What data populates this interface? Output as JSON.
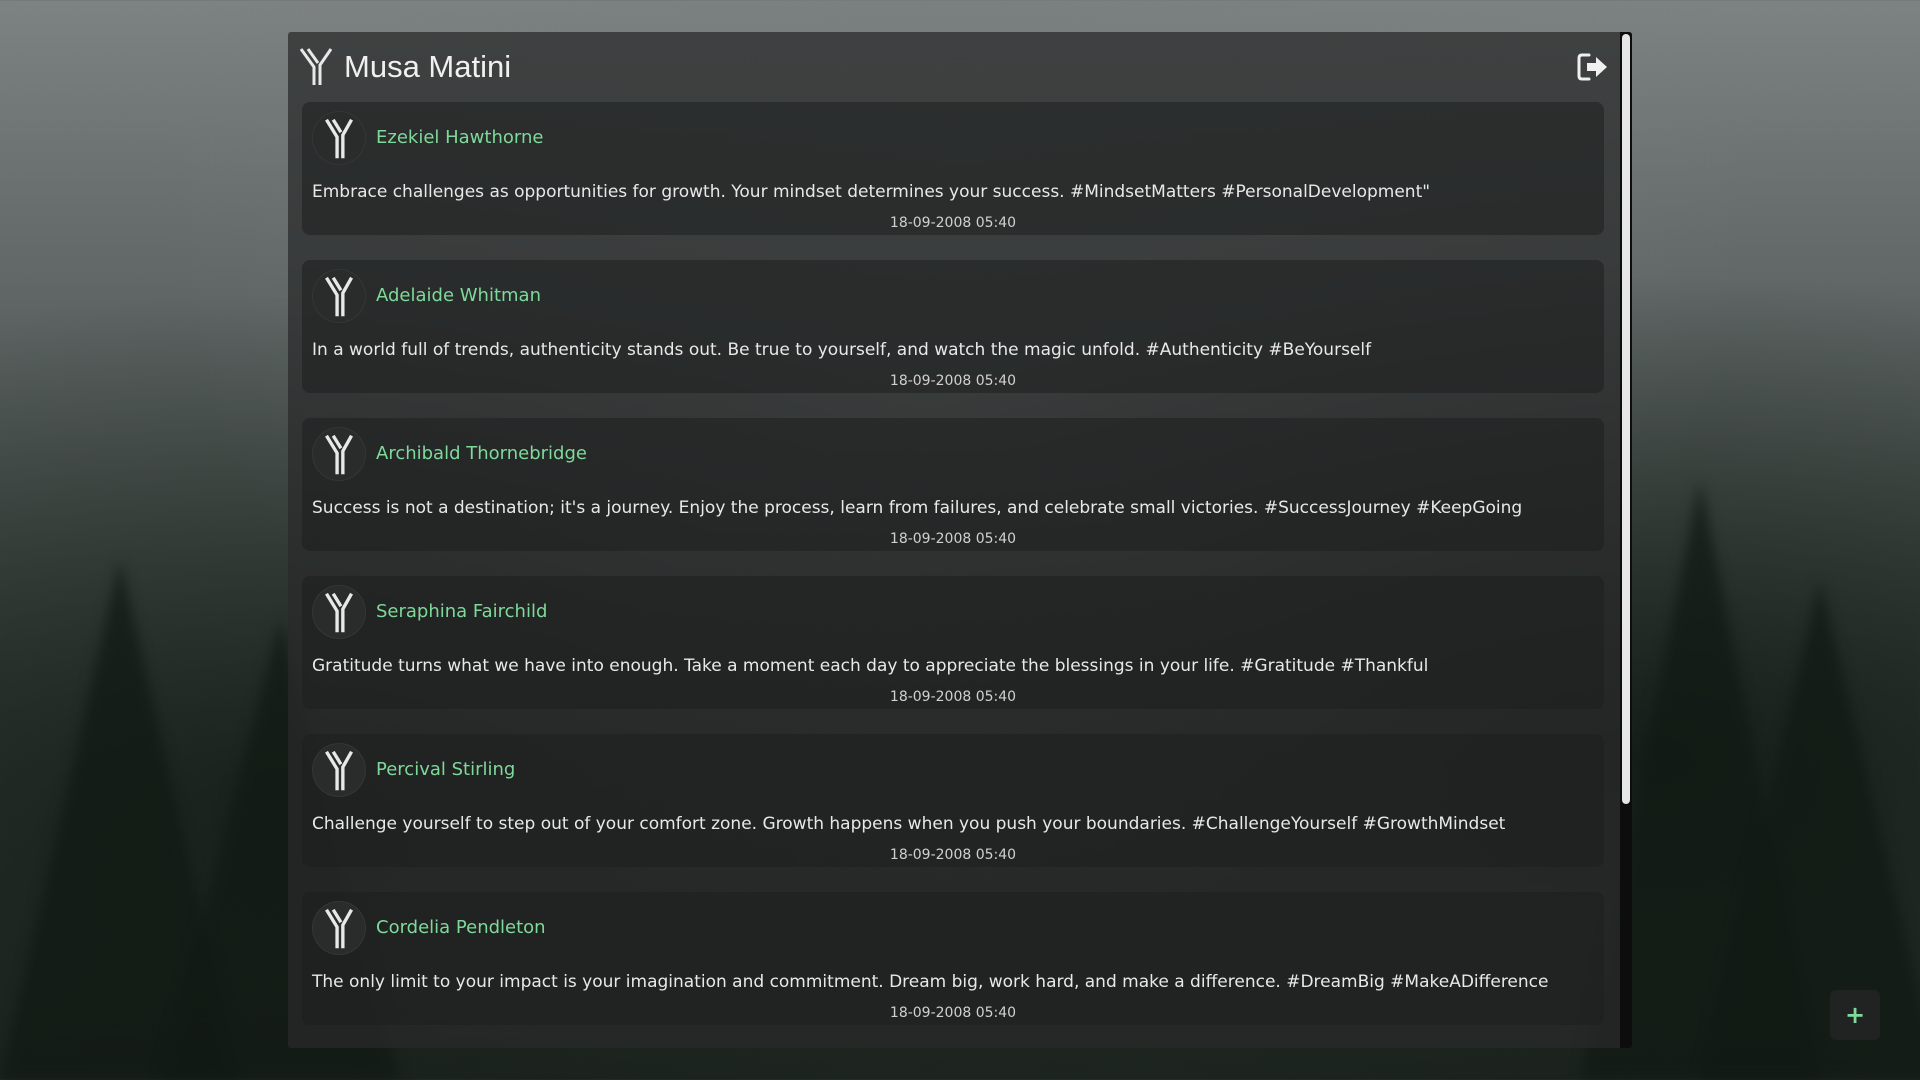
{
  "header": {
    "title": "Musa Matini",
    "logo_icon": "y-logo-icon",
    "logout_icon": "logout-icon"
  },
  "posts": [
    {
      "author": "Ezekiel Hawthorne",
      "text": "Embrace challenges as opportunities for growth. Your mindset determines your success. #MindsetMatters #PersonalDevelopment\"",
      "time": "18-09-2008 05:40"
    },
    {
      "author": "Adelaide Whitman",
      "text": "In a world full of trends, authenticity stands out. Be true to yourself, and watch the magic unfold. #Authenticity #BeYourself",
      "time": "18-09-2008 05:40"
    },
    {
      "author": "Archibald Thornebridge",
      "text": "Success is not a destination; it's a journey. Enjoy the process, learn from failures, and celebrate small victories. #SuccessJourney #KeepGoing",
      "time": "18-09-2008 05:40"
    },
    {
      "author": "Seraphina Fairchild",
      "text": "Gratitude turns what we have into enough. Take a moment each day to appreciate the blessings in your life. #Gratitude #Thankful",
      "time": "18-09-2008 05:40"
    },
    {
      "author": "Percival Stirling",
      "text": "Challenge yourself to step out of your comfort zone. Growth happens when you push your boundaries. #ChallengeYourself #GrowthMindset",
      "time": "18-09-2008 05:40"
    },
    {
      "author": "Cordelia Pendleton",
      "text": "The only limit to your impact is your imagination and commitment. Dream big, work hard, and make a difference. #DreamBig #MakeADifference",
      "time": "18-09-2008 05:40"
    }
  ],
  "fab": {
    "label": "+",
    "icon": "plus-icon"
  },
  "colors": {
    "accent": "#7ed99a",
    "text": "#e8e8e8",
    "panel": "#282a2a"
  }
}
